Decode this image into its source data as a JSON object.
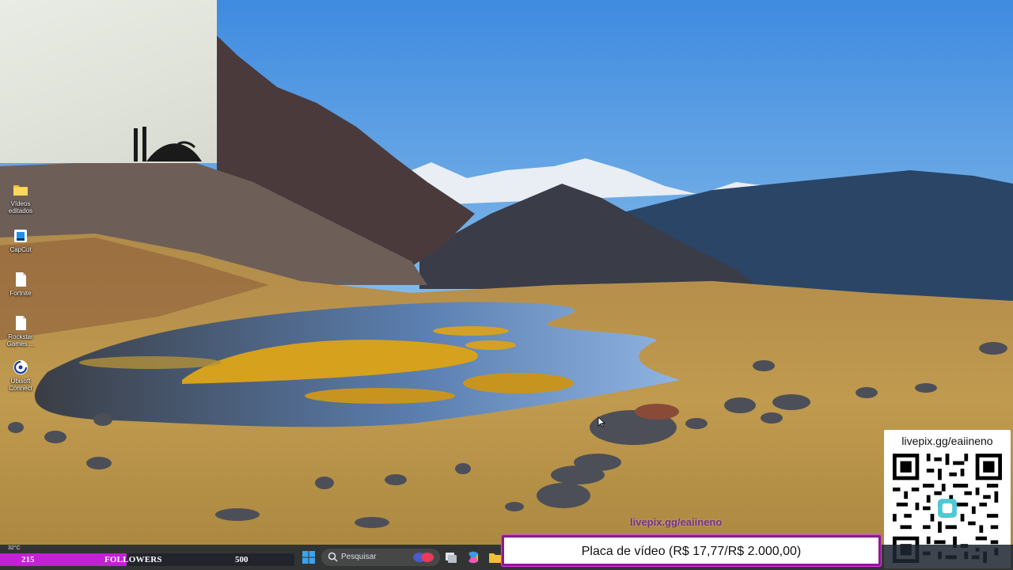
{
  "desktop": {
    "icons": [
      {
        "name": "folder-icon",
        "label": "Vídeos editados"
      },
      {
        "name": "capcut-icon",
        "label": "CapCut"
      },
      {
        "name": "file-icon",
        "label": "Fortnite"
      },
      {
        "name": "file-icon",
        "label": "Rockstar Games ..."
      },
      {
        "name": "ubisoft-icon",
        "label": "Ubisoft Connect"
      }
    ]
  },
  "overlay": {
    "watermark": "livepix.gg/eaiineno",
    "qr_url": "livepix.gg/eaiineno",
    "followers": {
      "current": "215",
      "label": "FOLLOWERS",
      "target": "500",
      "progress": 0.43
    },
    "goal_text": "Placa de vídeo (R$ 17,77/R$ 2.000,00)"
  },
  "taskbar": {
    "weather": "32°C",
    "search_placeholder": "Pesquisar"
  },
  "colors": {
    "follow_fill": "#c420d6",
    "goal_border": "#8a1a8e",
    "watermark": "#6c1f9a"
  }
}
